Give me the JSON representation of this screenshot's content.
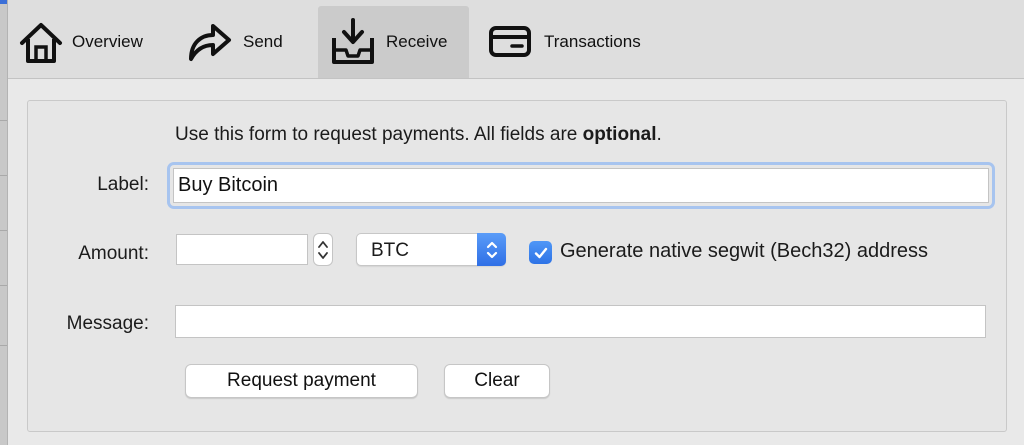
{
  "toolbar": {
    "tabs": [
      {
        "label": "Overview",
        "icon": "home-icon",
        "active": false
      },
      {
        "label": "Send",
        "icon": "send-arrow-icon",
        "active": false
      },
      {
        "label": "Receive",
        "icon": "receive-tray-icon",
        "active": true
      },
      {
        "label": "Transactions",
        "icon": "card-icon",
        "active": false
      }
    ]
  },
  "form": {
    "intro_prefix": "Use this form to request payments. All fields are ",
    "intro_bold": "optional",
    "intro_suffix": ".",
    "label_label": "Label:",
    "label_value": "Buy Bitcoin",
    "amount_label": "Amount:",
    "amount_value": "",
    "unit_value": "BTC",
    "segwit_label": "Generate native segwit (Bech32) address",
    "segwit_checked": true,
    "message_label": "Message:",
    "message_value": "",
    "request_button": "Request payment",
    "clear_button": "Clear"
  },
  "colors": {
    "accent": "#2f73e6",
    "focus_ring": "#a7c4ef",
    "toolbar_bg": "#dedede",
    "active_tab_bg": "#cbcbcb"
  }
}
